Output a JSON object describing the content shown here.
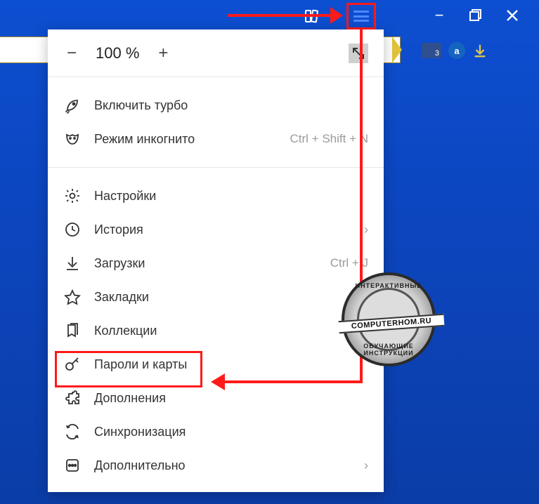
{
  "topbar": {
    "bookmarks_icon": "bookmarks-icon",
    "menu_icon": "menu-icon",
    "minimize": "−",
    "maximize": "❐",
    "close": "✕"
  },
  "address_bar": {
    "mail_badge": "3",
    "a_badge": "a"
  },
  "zoom": {
    "minus": "−",
    "value": "100 %",
    "plus": "+",
    "fullscreen_icon": "fullscreen-icon"
  },
  "menu": {
    "turbo": {
      "label": "Включить турбо"
    },
    "incognito": {
      "label": "Режим инкогнито",
      "shortcut": "Ctrl + Shift + N"
    },
    "settings": {
      "label": "Настройки"
    },
    "history": {
      "label": "История",
      "chevron": "›"
    },
    "downloads": {
      "label": "Загрузки",
      "shortcut": "Ctrl + J"
    },
    "bookmarks": {
      "label": "Закладки"
    },
    "collections": {
      "label": "Коллекции"
    },
    "passwords": {
      "label": "Пароли и карты"
    },
    "addons": {
      "label": "Дополнения"
    },
    "sync": {
      "label": "Синхронизация"
    },
    "more": {
      "label": "Дополнительно",
      "chevron": "›"
    }
  },
  "stamp": {
    "ring_top": "ИНТЕРАКТИВНЫЕ",
    "ring_bottom": "ОБУЧАЮЩИЕ ИНСТРУКЦИИ",
    "center": "COMPUTERHOM.RU"
  }
}
